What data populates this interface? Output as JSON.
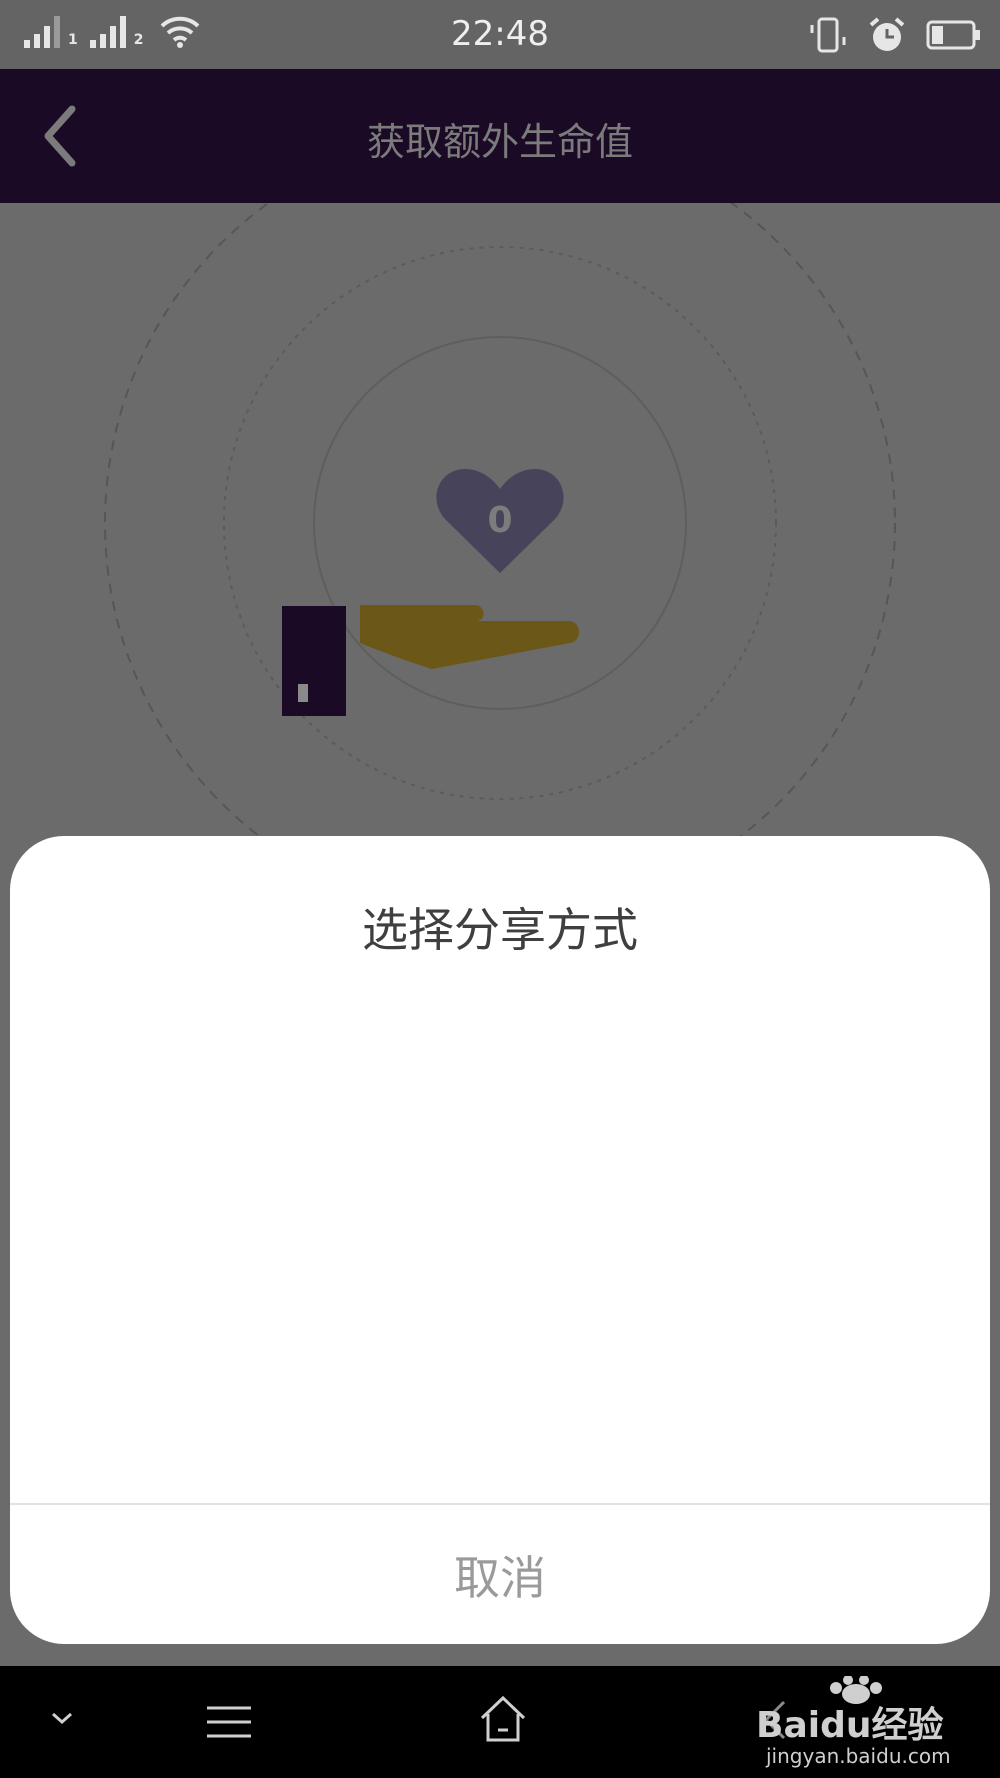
{
  "status_bar": {
    "time": "22:48",
    "sim1_label": "1",
    "sim2_label": "2",
    "icons": [
      "signal-icon",
      "wifi-icon",
      "vibrate-icon",
      "alarm-icon",
      "battery-icon"
    ],
    "battery_level": 0.25
  },
  "header": {
    "title": "获取额外生命值",
    "back_icon": "chevron-left-icon",
    "background": "#1b0a26"
  },
  "hero": {
    "heart_count": "0",
    "accent_color": "#d4a41a"
  },
  "share_sheet": {
    "title": "选择分享方式",
    "cancel_label": "取消"
  },
  "nav_bar": {
    "items": [
      "chevron-down-icon",
      "menu-icon",
      "home-icon",
      "back-icon"
    ]
  },
  "watermark": {
    "brand": "Baidu经验",
    "url": "jingyan.baidu.com"
  }
}
